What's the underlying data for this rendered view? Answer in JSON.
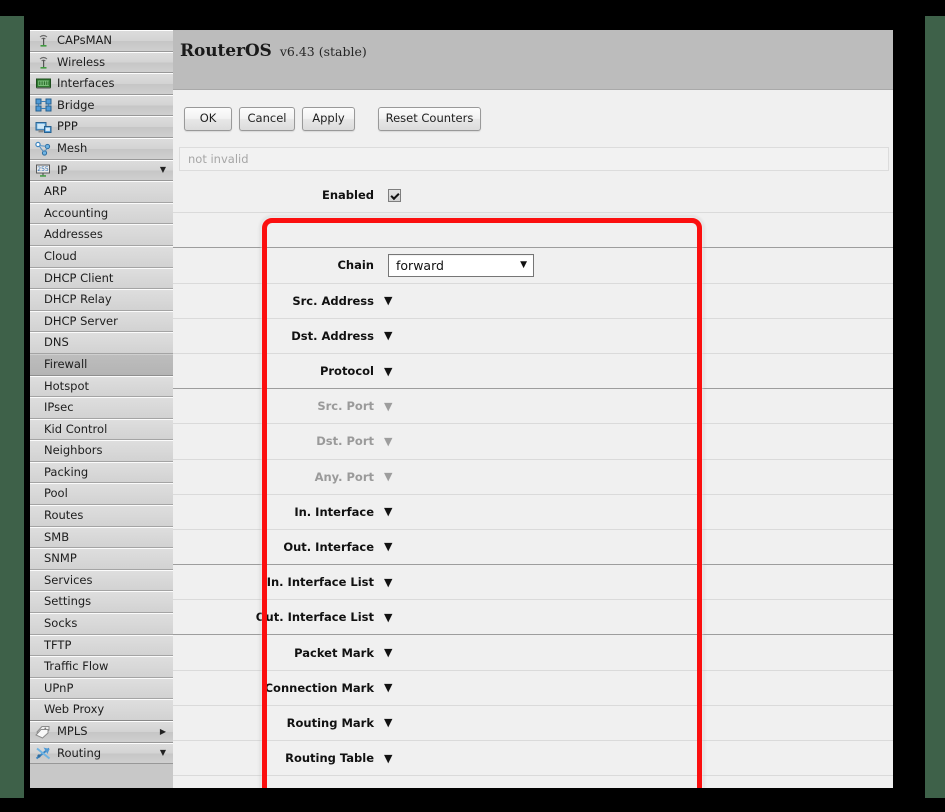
{
  "window": {
    "title_main": "RouterOS",
    "title_version": "v6.43 (stable)"
  },
  "sidebar": {
    "items": [
      {
        "label": "CAPsMAN",
        "icon": "antenna-icon",
        "type": "top",
        "arrow": ""
      },
      {
        "label": "Wireless",
        "icon": "antenna-icon",
        "type": "top",
        "arrow": ""
      },
      {
        "label": "Interfaces",
        "icon": "nic-card-icon",
        "type": "top",
        "arrow": ""
      },
      {
        "label": "Bridge",
        "icon": "bridge-icon",
        "type": "top",
        "arrow": ""
      },
      {
        "label": "PPP",
        "icon": "ppp-icon",
        "type": "top",
        "arrow": ""
      },
      {
        "label": "Mesh",
        "icon": "mesh-icon",
        "type": "top",
        "arrow": ""
      },
      {
        "label": "IP",
        "icon": "ip-255-icon",
        "type": "top",
        "arrow": "▼"
      },
      {
        "label": "ARP",
        "icon": "",
        "type": "sub",
        "arrow": ""
      },
      {
        "label": "Accounting",
        "icon": "",
        "type": "sub",
        "arrow": ""
      },
      {
        "label": "Addresses",
        "icon": "",
        "type": "sub",
        "arrow": ""
      },
      {
        "label": "Cloud",
        "icon": "",
        "type": "sub",
        "arrow": ""
      },
      {
        "label": "DHCP Client",
        "icon": "",
        "type": "sub",
        "arrow": ""
      },
      {
        "label": "DHCP Relay",
        "icon": "",
        "type": "sub",
        "arrow": ""
      },
      {
        "label": "DHCP Server",
        "icon": "",
        "type": "sub",
        "arrow": ""
      },
      {
        "label": "DNS",
        "icon": "",
        "type": "sub",
        "arrow": ""
      },
      {
        "label": "Firewall",
        "icon": "",
        "type": "sub",
        "arrow": "",
        "selected": true
      },
      {
        "label": "Hotspot",
        "icon": "",
        "type": "sub",
        "arrow": ""
      },
      {
        "label": "IPsec",
        "icon": "",
        "type": "sub",
        "arrow": ""
      },
      {
        "label": "Kid Control",
        "icon": "",
        "type": "sub",
        "arrow": ""
      },
      {
        "label": "Neighbors",
        "icon": "",
        "type": "sub",
        "arrow": ""
      },
      {
        "label": "Packing",
        "icon": "",
        "type": "sub",
        "arrow": ""
      },
      {
        "label": "Pool",
        "icon": "",
        "type": "sub",
        "arrow": ""
      },
      {
        "label": "Routes",
        "icon": "",
        "type": "sub",
        "arrow": ""
      },
      {
        "label": "SMB",
        "icon": "",
        "type": "sub",
        "arrow": ""
      },
      {
        "label": "SNMP",
        "icon": "",
        "type": "sub",
        "arrow": ""
      },
      {
        "label": "Services",
        "icon": "",
        "type": "sub",
        "arrow": ""
      },
      {
        "label": "Settings",
        "icon": "",
        "type": "sub",
        "arrow": ""
      },
      {
        "label": "Socks",
        "icon": "",
        "type": "sub",
        "arrow": ""
      },
      {
        "label": "TFTP",
        "icon": "",
        "type": "sub",
        "arrow": ""
      },
      {
        "label": "Traffic Flow",
        "icon": "",
        "type": "sub",
        "arrow": ""
      },
      {
        "label": "UPnP",
        "icon": "",
        "type": "sub",
        "arrow": ""
      },
      {
        "label": "Web Proxy",
        "icon": "",
        "type": "sub",
        "arrow": "",
        "last": true
      },
      {
        "label": "MPLS",
        "icon": "mpls-tags-icon",
        "type": "top",
        "arrow": "▶"
      },
      {
        "label": "Routing",
        "icon": "routing-icon",
        "type": "top",
        "arrow": "▼"
      }
    ]
  },
  "toolbar": {
    "ok_label": "OK",
    "cancel_label": "Cancel",
    "apply_label": "Apply",
    "reset_counters_label": "Reset Counters"
  },
  "status": {
    "text": "not invalid"
  },
  "form": {
    "rows": [
      {
        "label": "Enabled",
        "control": "checkbox",
        "value": "checked",
        "disabled": false,
        "group_end": false
      },
      {
        "label": "",
        "control": "none",
        "value": "",
        "disabled": false,
        "group_end": true
      },
      {
        "label": "Chain",
        "control": "select",
        "value": "forward",
        "disabled": false,
        "group_end": false
      },
      {
        "label": "Src. Address",
        "control": "caret",
        "value": "",
        "disabled": false,
        "group_end": false
      },
      {
        "label": "Dst. Address",
        "control": "caret",
        "value": "",
        "disabled": false,
        "group_end": false
      },
      {
        "label": "Protocol",
        "control": "caret",
        "value": "",
        "disabled": false,
        "group_end": true
      },
      {
        "label": "Src. Port",
        "control": "caret",
        "value": "",
        "disabled": true,
        "group_end": false
      },
      {
        "label": "Dst. Port",
        "control": "caret",
        "value": "",
        "disabled": true,
        "group_end": false
      },
      {
        "label": "Any. Port",
        "control": "caret",
        "value": "",
        "disabled": true,
        "group_end": false
      },
      {
        "label": "In. Interface",
        "control": "caret",
        "value": "",
        "disabled": false,
        "group_end": false
      },
      {
        "label": "Out. Interface",
        "control": "caret",
        "value": "",
        "disabled": false,
        "group_end": true
      },
      {
        "label": "In. Interface List",
        "control": "caret",
        "value": "",
        "disabled": false,
        "group_end": false
      },
      {
        "label": "Out. Interface List",
        "control": "caret",
        "value": "",
        "disabled": false,
        "group_end": true
      },
      {
        "label": "Packet Mark",
        "control": "caret",
        "value": "",
        "disabled": false,
        "group_end": false
      },
      {
        "label": "Connection Mark",
        "control": "caret",
        "value": "",
        "disabled": false,
        "group_end": false
      },
      {
        "label": "Routing Mark",
        "control": "caret",
        "value": "",
        "disabled": false,
        "group_end": false
      },
      {
        "label": "Routing Table",
        "control": "caret",
        "value": "",
        "disabled": false,
        "group_end": false
      }
    ]
  },
  "annotation": {
    "highlight_color": "#fb0f0f"
  }
}
